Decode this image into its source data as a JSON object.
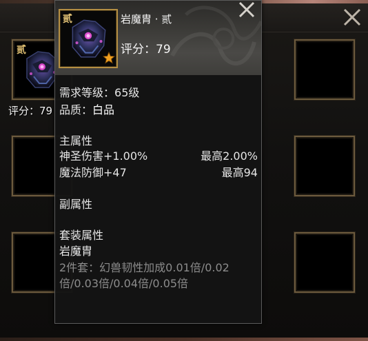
{
  "background_panel": {
    "equipped_item_tag": "贰",
    "equipped_item_score_label": "评分：79",
    "close_icon": "close-x-icon"
  },
  "tooltip": {
    "item_tag": "贰",
    "item_name": "岩魔胄 · 贰",
    "score_label": "评分：",
    "score_value": "79",
    "close_icon": "close-x-icon",
    "star_icon": "star-icon",
    "requirement_label": "需求等级：",
    "requirement_value": "65级",
    "quality_label": "品质：",
    "quality_value": "白品",
    "main_attr_title": "主属性",
    "main_attrs": [
      {
        "name": "神圣伤害+1.00%",
        "max": "最高2.00%"
      },
      {
        "name": "魔法防御+47",
        "max": "最高94"
      }
    ],
    "sub_attr_title": "副属性",
    "set_attr_title": "套装属性",
    "set_name": "岩魔胄",
    "set_bonus_line1": "2件套：幻兽韧性加成0.01倍/0.02",
    "set_bonus_line2": "倍/0.03倍/0.04倍/0.05倍"
  },
  "colors": {
    "slot_border": "#6c5a3d",
    "icon_frame_gold": "#b58f43",
    "tag_gold": "#e1c072",
    "gray_text": "#8c8c8c",
    "star_fill": "#f0a020"
  }
}
